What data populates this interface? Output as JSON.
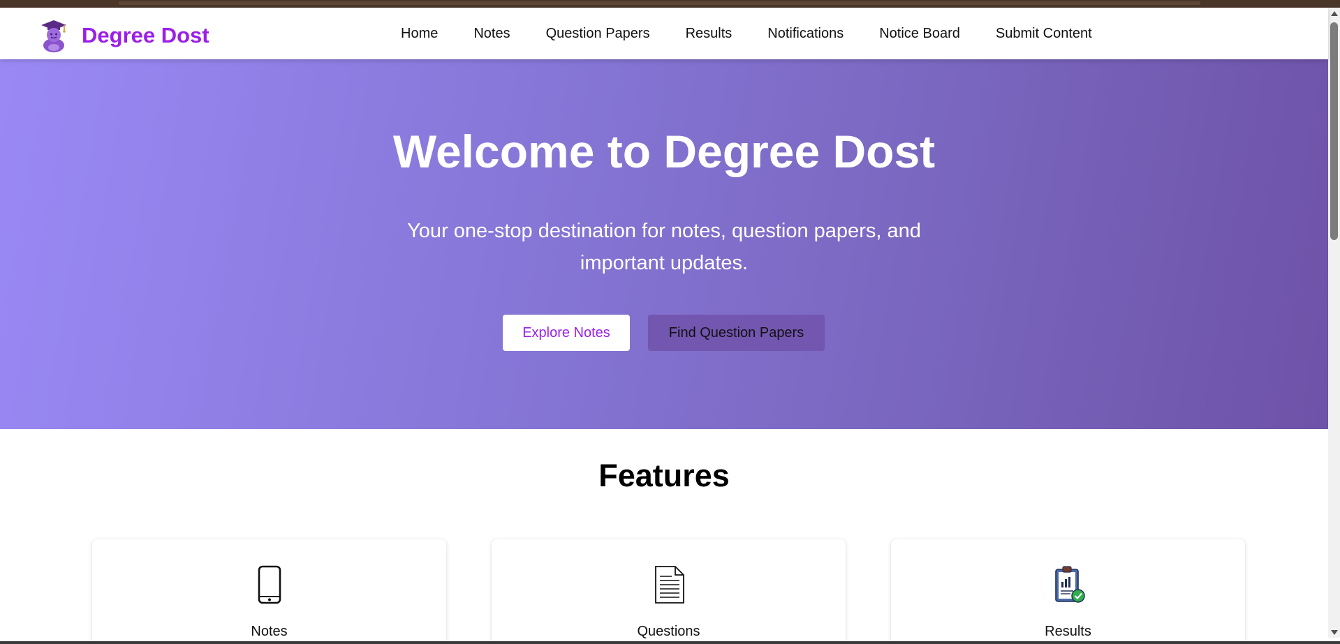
{
  "brand": {
    "name": "Degree Dost",
    "logo_icon": "graduate-mascot-icon",
    "color": "#9b1fe8"
  },
  "nav": {
    "links": [
      {
        "label": "Home"
      },
      {
        "label": "Notes"
      },
      {
        "label": "Question Papers"
      },
      {
        "label": "Results"
      },
      {
        "label": "Notifications"
      },
      {
        "label": "Notice Board"
      },
      {
        "label": "Submit Content"
      }
    ]
  },
  "hero": {
    "title": "Welcome to Degree Dost",
    "subtitle": "Your one-stop destination for notes, question papers, and important updates.",
    "primary_button": "Explore Notes",
    "secondary_button": "Find Question Papers",
    "gradient_start": "#9a89f5",
    "gradient_end": "#6e52a8"
  },
  "features": {
    "heading": "Features",
    "cards": [
      {
        "title": "Notes",
        "icon": "tablet-icon"
      },
      {
        "title": "Questions",
        "icon": "document-icon"
      },
      {
        "title": "Results",
        "icon": "clipboard-chart-check-icon"
      }
    ]
  }
}
